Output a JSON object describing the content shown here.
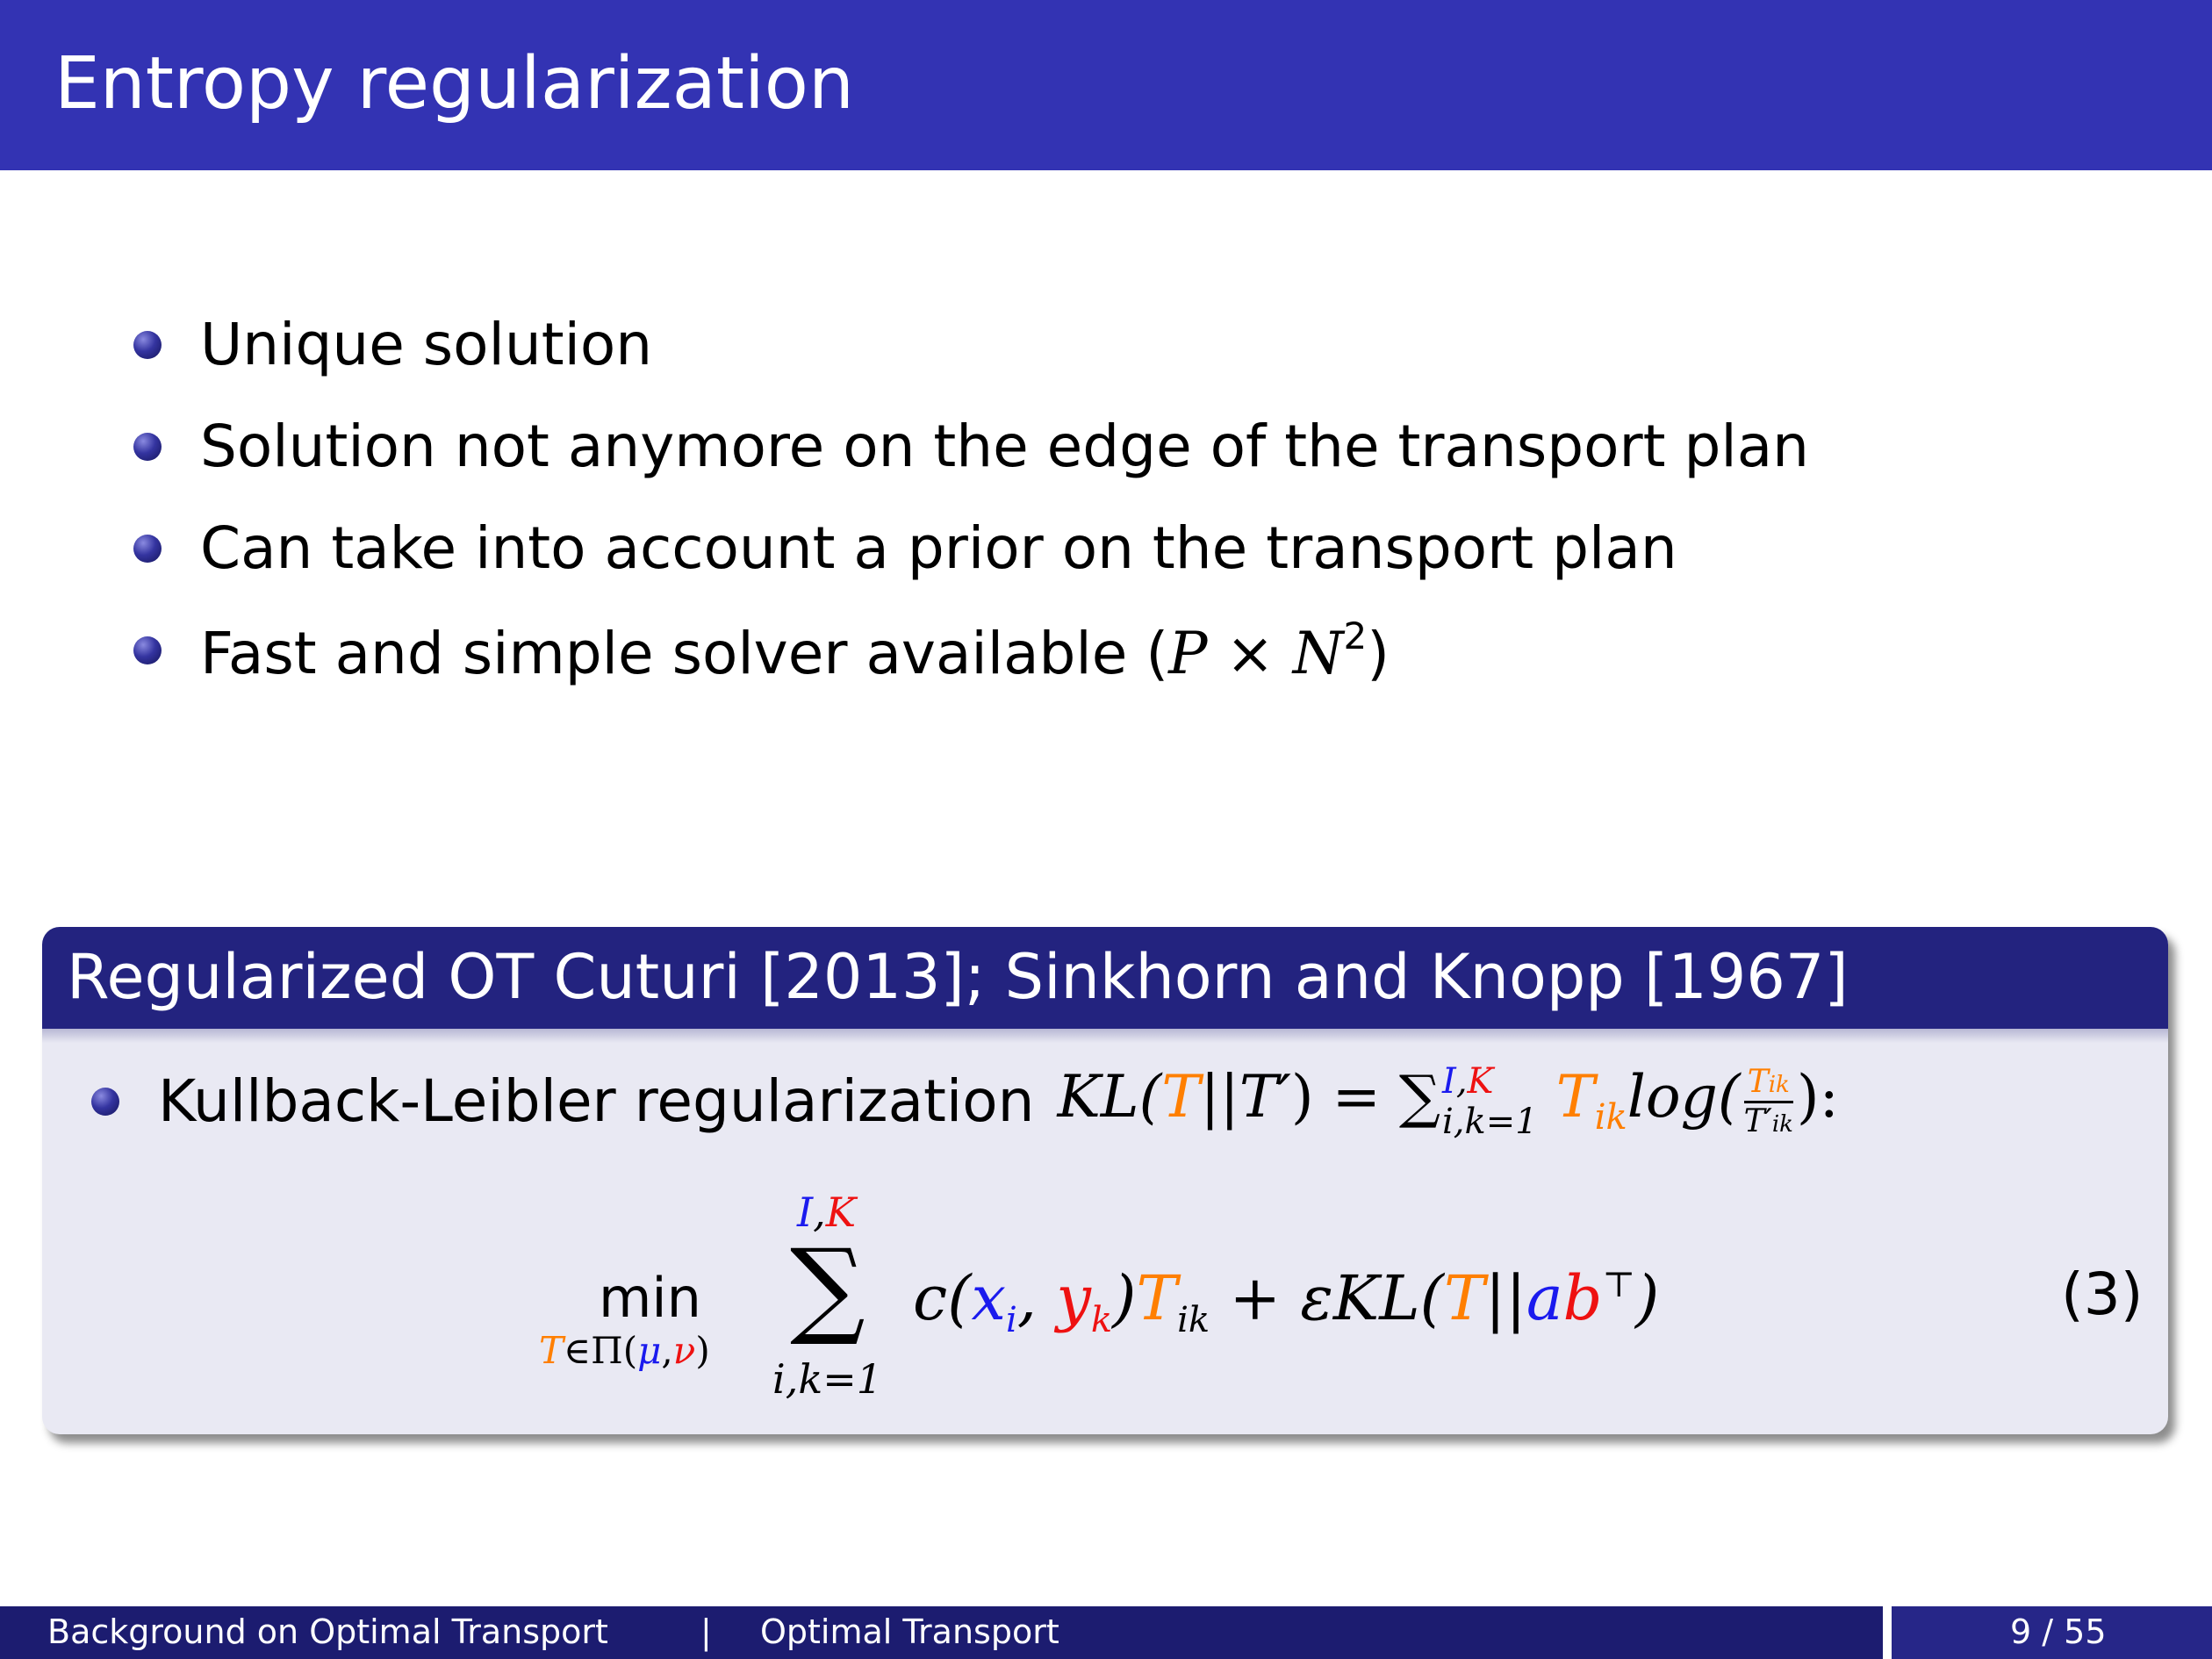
{
  "slide": {
    "title": "Entropy regularization"
  },
  "bullets": [
    "Unique solution",
    "Solution not anymore on the edge of the transport plan",
    "Can take into account a prior on the transport plan",
    "Fast and simple solver available ("
  ],
  "bullet4_math": {
    "p": "P",
    "times": "×",
    "n": "N",
    "exp": "2",
    "close": ")"
  },
  "block": {
    "title": "Regularized OT Cuturi [2013]; Sinkhorn and Knopp [1967]",
    "kl_label": "Kullback-Leibler regularization",
    "kl_formula": {
      "lhs_kl": "KL(",
      "lhs_t": "T",
      "lhs_bar": "||",
      "lhs_tp": "T′",
      "lhs_close": ") =",
      "sum": "∑",
      "sum_sup_i": "I",
      "sum_sup_comma": ",",
      "sum_sup_k": "K",
      "sum_sub": "i,k=1",
      "t_ik": "T",
      "t_ik_sub": "ik",
      "log": "log(",
      "frac_num": "T",
      "frac_num_sub": "ik",
      "frac_den": "T′",
      "frac_den_sub": "ik",
      "end": "):"
    },
    "equation": {
      "min": "min",
      "min_sub_t": "T",
      "min_sub_in": "∈Π(",
      "min_sub_mu": "μ",
      "min_sub_comma": ",",
      "min_sub_nu": "ν",
      "min_sub_close": ")",
      "sum_top_i": "I",
      "sum_top_comma": ",",
      "sum_top_k": "K",
      "sum_symbol": "∑",
      "sum_bottom": "i,k=1",
      "c_open": "c(",
      "x": "x",
      "x_sub": "i",
      "comma": ",",
      "y": "y",
      "y_sub": "k",
      "c_close": ")",
      "t": "T",
      "t_sub": "ik",
      "plus_eps_kl": "+ εKL(",
      "t2": "T",
      "bar": "||",
      "a": "a",
      "b": "b",
      "top": "⊤",
      "end": ")",
      "number": "(3)"
    }
  },
  "footer": {
    "section": "Background on Optimal Transport",
    "separator": "|",
    "subsection": "Optimal Transport",
    "page": "9 / 55"
  },
  "colors": {
    "title_bar": "#3333b3",
    "block_header": "#23237f",
    "block_body": "#e9e9f3",
    "orange": "#ff7f00",
    "red": "#ee1111",
    "blue": "#1a1aee"
  }
}
